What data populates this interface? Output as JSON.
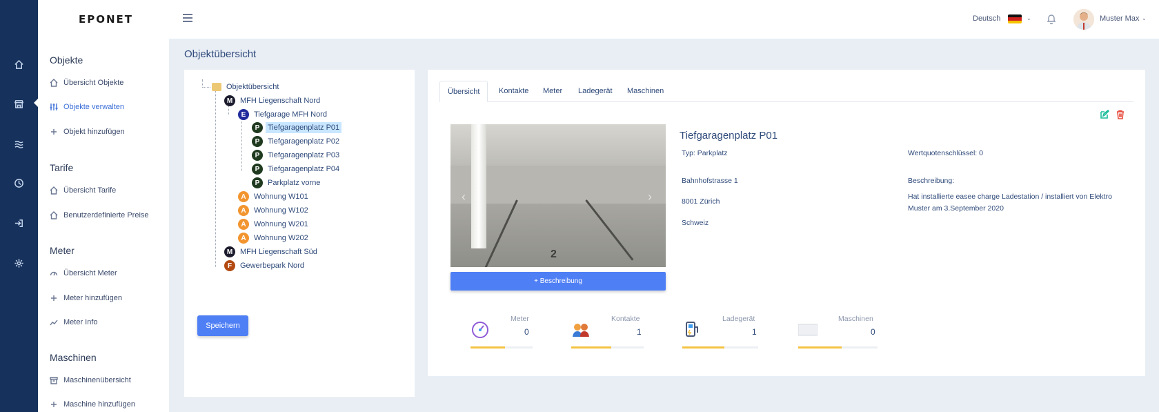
{
  "app": {
    "logo": "EPONET"
  },
  "rail": {
    "items": [
      "home-icon",
      "store-icon",
      "waves-icon",
      "clock-icon",
      "sign-in-icon",
      "settings-icon"
    ]
  },
  "sidebar": {
    "sections": [
      {
        "title": "Objekte",
        "items": [
          {
            "label": "Übersicht Objekte",
            "icon": "home-icon"
          },
          {
            "label": "Objekte verwalten",
            "icon": "sliders-icon",
            "active": true
          },
          {
            "label": "Objekt hinzufügen",
            "icon": "plus-icon"
          }
        ]
      },
      {
        "title": "Tarife",
        "items": [
          {
            "label": "Übersicht Tarife",
            "icon": "home-icon"
          },
          {
            "label": "Benutzerdefinierte Preise",
            "icon": "home-icon"
          }
        ]
      },
      {
        "title": "Meter",
        "items": [
          {
            "label": "Übersicht Meter",
            "icon": "gauge-icon"
          },
          {
            "label": "Meter hinzufügen",
            "icon": "plus-icon"
          },
          {
            "label": "Meter Info",
            "icon": "chart-icon"
          }
        ]
      },
      {
        "title": "Maschinen",
        "items": [
          {
            "label": "Maschinenübersicht",
            "icon": "archive-icon"
          },
          {
            "label": "Maschine hinzufügen",
            "icon": "plus-icon"
          }
        ]
      }
    ]
  },
  "topbar": {
    "language": "Deutsch",
    "user_name": "Muster Max"
  },
  "page": {
    "title": "Objektübersicht"
  },
  "tree": {
    "root": "Objektübersicht",
    "nodes": [
      {
        "badge": "M",
        "label": "MFH Liegenschaft Nord",
        "color": "#1c1c2e"
      },
      {
        "badge": "E",
        "label": "Tiefgarage MFH Nord",
        "color": "#1f2a9b"
      },
      {
        "badge": "P",
        "label": "Tiefgaragenplatz P01",
        "color": "#1f3a1f",
        "selected": true
      },
      {
        "badge": "P",
        "label": "Tiefgaragenplatz P02",
        "color": "#1f3a1f"
      },
      {
        "badge": "P",
        "label": "Tiefgaragenplatz P03",
        "color": "#1f3a1f"
      },
      {
        "badge": "P",
        "label": "Tiefgaragenplatz P04",
        "color": "#1f3a1f"
      },
      {
        "badge": "P",
        "label": "Parkplatz vorne",
        "color": "#1f3a1f"
      },
      {
        "badge": "A",
        "label": "Wohnung W101",
        "color": "#f2952f"
      },
      {
        "badge": "A",
        "label": "Wohnung W102",
        "color": "#f2952f"
      },
      {
        "badge": "A",
        "label": "Wohnung W201",
        "color": "#f2952f"
      },
      {
        "badge": "A",
        "label": "Wohnung W202",
        "color": "#f2952f"
      },
      {
        "badge": "M",
        "label": "MFH Liegenschaft Süd",
        "color": "#1c1c2e"
      },
      {
        "badge": "F",
        "label": "Gewerbepark Nord",
        "color": "#b34a12"
      }
    ],
    "save_label": "Speichern"
  },
  "detail": {
    "tabs": [
      "Übersicht",
      "Kontakte",
      "Meter",
      "Ladegerät",
      "Maschinen"
    ],
    "active_tab": "Übersicht",
    "photo_number": "2",
    "description_button": "+ Beschreibung",
    "title": "Tiefgaragenplatz P01",
    "type": "Typ: Parkplatz",
    "quota": "Wertquotenschlüssel: 0",
    "street": "Bahnhofstrasse 1",
    "city": "8001 Zürich",
    "country": "Schweiz",
    "description_label": "Beschreibung:",
    "description_text": "Hat installierte easee charge Ladestation / installiert von Elektro Muster am 3.September 2020",
    "stats": [
      {
        "label": "Meter",
        "value": "0",
        "icon": "speedometer-icon",
        "fill": 0.55
      },
      {
        "label": "Kontakte",
        "value": "1",
        "icon": "people-icon",
        "fill": 0.55
      },
      {
        "label": "Ladegerät",
        "value": "1",
        "icon": "charger-icon",
        "fill": 0.55
      },
      {
        "label": "Maschinen",
        "value": "0",
        "icon": "machine-icon",
        "fill": 0.55
      }
    ]
  },
  "colors": {
    "rail": "#16325c",
    "accent": "#4f7ff5",
    "progress": "#f4c342",
    "delete": "#e74c3c",
    "edit": "#1abc9c"
  }
}
